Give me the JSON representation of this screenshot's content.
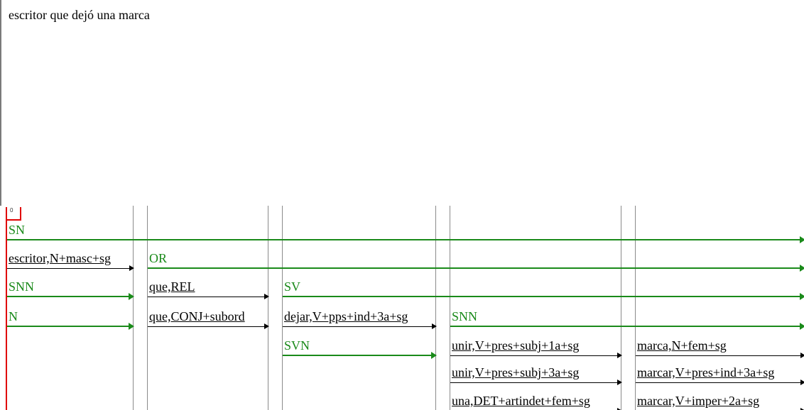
{
  "editor": {
    "text": "escritor que dejó una marca"
  },
  "state_index": "0",
  "rows": [
    {
      "label": "SN",
      "kind": "green"
    },
    {
      "label": "escritor,N+masc+sg",
      "kind": "black"
    },
    {
      "label": "OR",
      "kind": "green"
    },
    {
      "label": "SNN",
      "kind": "green"
    },
    {
      "label": "que,REL",
      "kind": "black"
    },
    {
      "label": "SV",
      "kind": "green"
    },
    {
      "label": "N",
      "kind": "green"
    },
    {
      "label": "que,CONJ+subord",
      "kind": "black"
    },
    {
      "label": "dejar,V+pps+ind+3a+sg",
      "kind": "black"
    },
    {
      "label": "SNN",
      "kind": "green"
    },
    {
      "label": "SVN",
      "kind": "green"
    },
    {
      "label": "unir,V+pres+subj+1a+sg",
      "kind": "black"
    },
    {
      "label": "marca,N+fem+sg",
      "kind": "black"
    },
    {
      "label": "unir,V+pres+subj+3a+sg",
      "kind": "black"
    },
    {
      "label": "marcar,V+pres+ind+3a+sg",
      "kind": "black"
    },
    {
      "label": "una,DET+artindet+fem+sg",
      "kind": "black"
    },
    {
      "label": "marcar,V+imper+2a+sg",
      "kind": "black"
    }
  ],
  "colors": {
    "green": "#1a8a1a",
    "black": "#000000",
    "cursor_box": "#e00000",
    "separator": "#8a8a8a",
    "index": "#1f3ec9"
  }
}
